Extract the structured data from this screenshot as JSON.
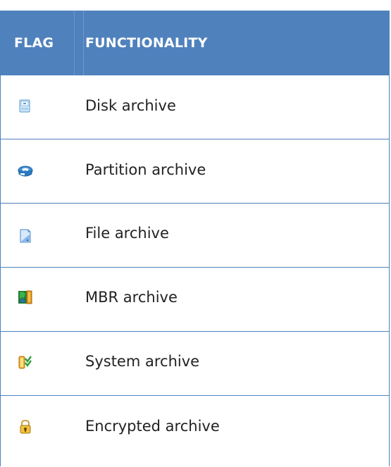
{
  "table": {
    "headers": {
      "flag": "FLAG",
      "functionality": "FUNCTIONALITY"
    },
    "rows": [
      {
        "icon": "disk-archive-icon",
        "label": "Disk archive"
      },
      {
        "icon": "partition-archive-icon",
        "label": "Partition archive"
      },
      {
        "icon": "file-archive-icon",
        "label": "File archive"
      },
      {
        "icon": "mbr-archive-icon",
        "label": "MBR archive"
      },
      {
        "icon": "system-archive-icon",
        "label": "System archive"
      },
      {
        "icon": "encrypted-archive-icon",
        "label": "Encrypted archive"
      }
    ]
  },
  "colors": {
    "header_bg": "#4f81bd",
    "header_text": "#ffffff",
    "border": "#4f81bd"
  }
}
